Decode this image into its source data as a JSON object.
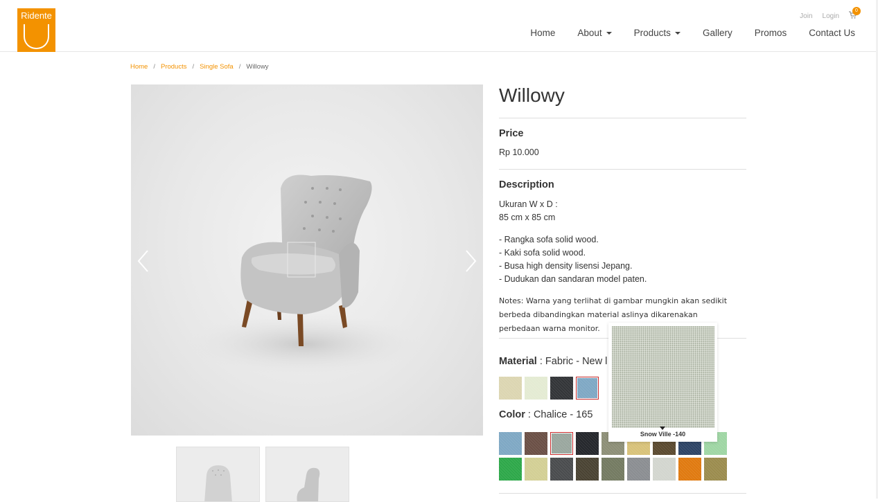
{
  "brand": {
    "logo_text": "Ridente",
    "accent": "#f39200"
  },
  "top_links": {
    "join": "Join",
    "login": "Login",
    "cart_count": "0"
  },
  "nav": [
    {
      "label": "Home",
      "dropdown": false
    },
    {
      "label": "About",
      "dropdown": true
    },
    {
      "label": "Products",
      "dropdown": true
    },
    {
      "label": "Gallery",
      "dropdown": false
    },
    {
      "label": "Promos",
      "dropdown": false
    },
    {
      "label": "Contact Us",
      "dropdown": false
    }
  ],
  "breadcrumb": {
    "home": "Home",
    "products": "Products",
    "category": "Single Sofa",
    "current": "Willowy",
    "sep": "/"
  },
  "product": {
    "title": "Willowy",
    "price_label": "Price",
    "price": "Rp 10.000",
    "description_label": "Description",
    "size_label": "Ukuran W x D :",
    "size_value": "85 cm x 85 cm",
    "features": [
      "- Rangka sofa solid wood.",
      "- Kaki sofa solid wood.",
      "- Busa high density lisensi Jepang.",
      "- Dudukan dan sandaran model paten."
    ],
    "notes": "Notes: Warna yang terlihat di gambar mungkin akan sedikit berbeda dibandingkan material aslinya dikarenakan perbedaan warna monitor.",
    "material_label": "Material",
    "material_value": " : Fabric - New l",
    "color_label": "Color",
    "color_value": " : Chalice - 165"
  },
  "material_swatches": [
    {
      "color": "#dcd6b2",
      "selected": false
    },
    {
      "color": "#e4ebd3",
      "selected": false
    },
    {
      "color": "#333538",
      "selected": false
    },
    {
      "color": "#7fa8c4",
      "selected": true
    }
  ],
  "color_swatches_row1": [
    {
      "color": "#7fa8c4",
      "selected": false
    },
    {
      "color": "#6b5046",
      "selected": false
    },
    {
      "color": "#9aa79f",
      "selected": true
    },
    {
      "color": "#25272c",
      "selected": false
    },
    {
      "color": "#8d8f77",
      "selected": false
    },
    {
      "color": "#d8c27a",
      "selected": false
    },
    {
      "color": "#5b4a30",
      "selected": false
    },
    {
      "color": "#2e4466",
      "selected": false
    },
    {
      "color": "#9fd6a4",
      "selected": false
    }
  ],
  "color_swatches_row2": [
    {
      "color": "#2ea84a",
      "selected": false
    },
    {
      "color": "#d3cf95",
      "selected": false
    },
    {
      "color": "#4a4c4e",
      "selected": false
    },
    {
      "color": "#4a4333",
      "selected": false
    },
    {
      "color": "#747b62",
      "selected": false
    },
    {
      "color": "#8b8e92",
      "selected": false
    },
    {
      "color": "#d3d6cf",
      "selected": false
    },
    {
      "color": "#e07a10",
      "selected": false
    },
    {
      "color": "#9b8c4e",
      "selected": false
    }
  ],
  "tooltip": {
    "label": "Snow Ville -140"
  },
  "icons": {
    "prev": "chevron-left-icon",
    "next": "chevron-right-icon",
    "cart": "cart-icon"
  }
}
